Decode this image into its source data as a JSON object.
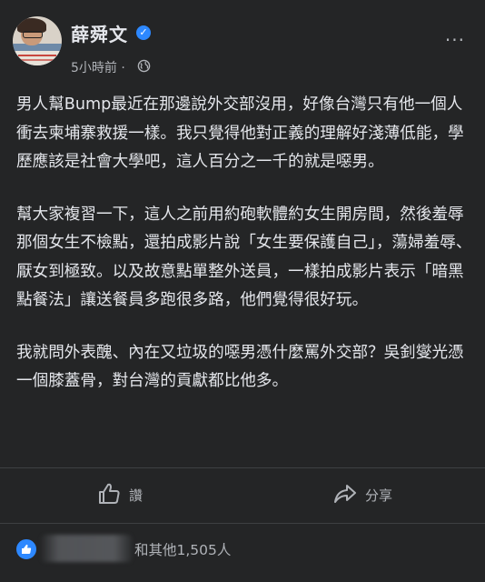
{
  "post": {
    "author": "薛舜文",
    "time": "5小時前",
    "more_label": "···",
    "verified_icon": "check-badge-icon",
    "privacy_icon": "globe-icon",
    "paragraphs": [
      "男人幫Bump最近在那邊說外交部沒用，好像台灣只有他一個人衝去柬埔寨救援一樣。我只覺得他對正義的理解好淺薄低能，學歷應該是社會大學吧，這人百分之一千的就是噁男。",
      "幫大家複習一下，這人之前用約砲軟體約女生開房間，然後羞辱那個女生不檢點，還拍成影片說「女生要保護自己」，蕩婦羞辱、厭女到極致。以及故意點單整外送員，一樣拍成影片表示「暗黑點餐法」讓送餐員多跑很多路，他們覺得很好玩。",
      "我就問外表醜、內在又垃圾的噁男憑什麼罵外交部？吳釗燮光憑一個膝蓋骨，對台灣的貢獻都比他多。"
    ]
  },
  "actions": {
    "like_label": "讚",
    "share_label": "分享"
  },
  "reactions": {
    "summary_suffix": "和其他1,505人",
    "icon": "like-reaction-icon"
  },
  "colors": {
    "background": "#242526",
    "text": "#e4e6eb",
    "secondary": "#b0b3b8",
    "accent": "#2d88ff"
  }
}
